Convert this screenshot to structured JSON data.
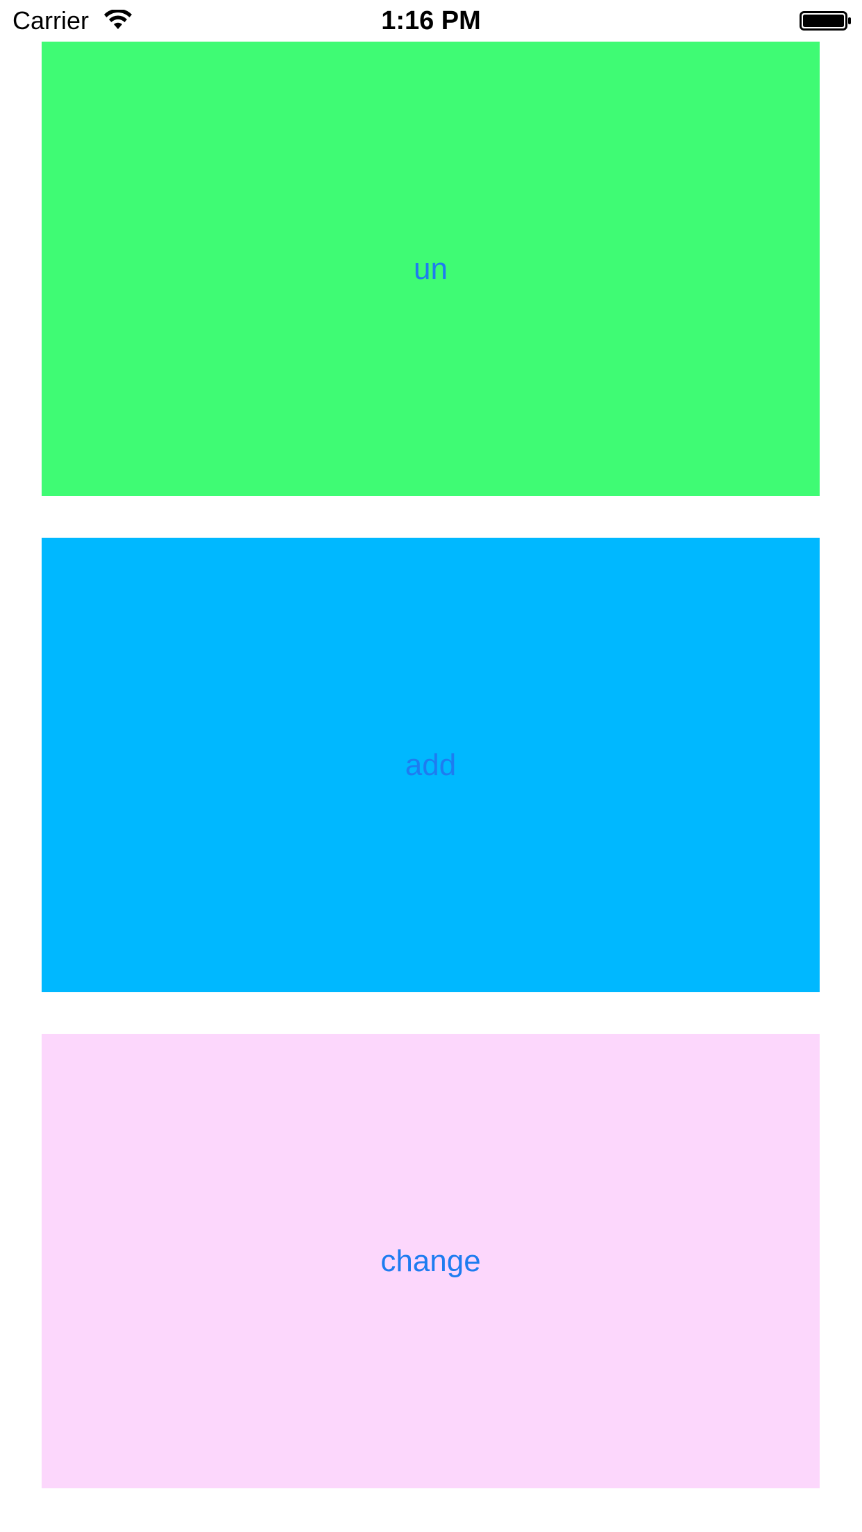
{
  "status_bar": {
    "carrier": "Carrier",
    "time": "1:16 PM",
    "wifi_icon": "wifi-icon",
    "battery_icon": "battery-icon"
  },
  "colors": {
    "label": "#1e7cf0",
    "panel_un": "#3ffb74",
    "panel_add": "#00b8ff",
    "panel_change": "#fcd7fc"
  },
  "panels": [
    {
      "label": "un"
    },
    {
      "label": "add"
    },
    {
      "label": "change"
    }
  ]
}
